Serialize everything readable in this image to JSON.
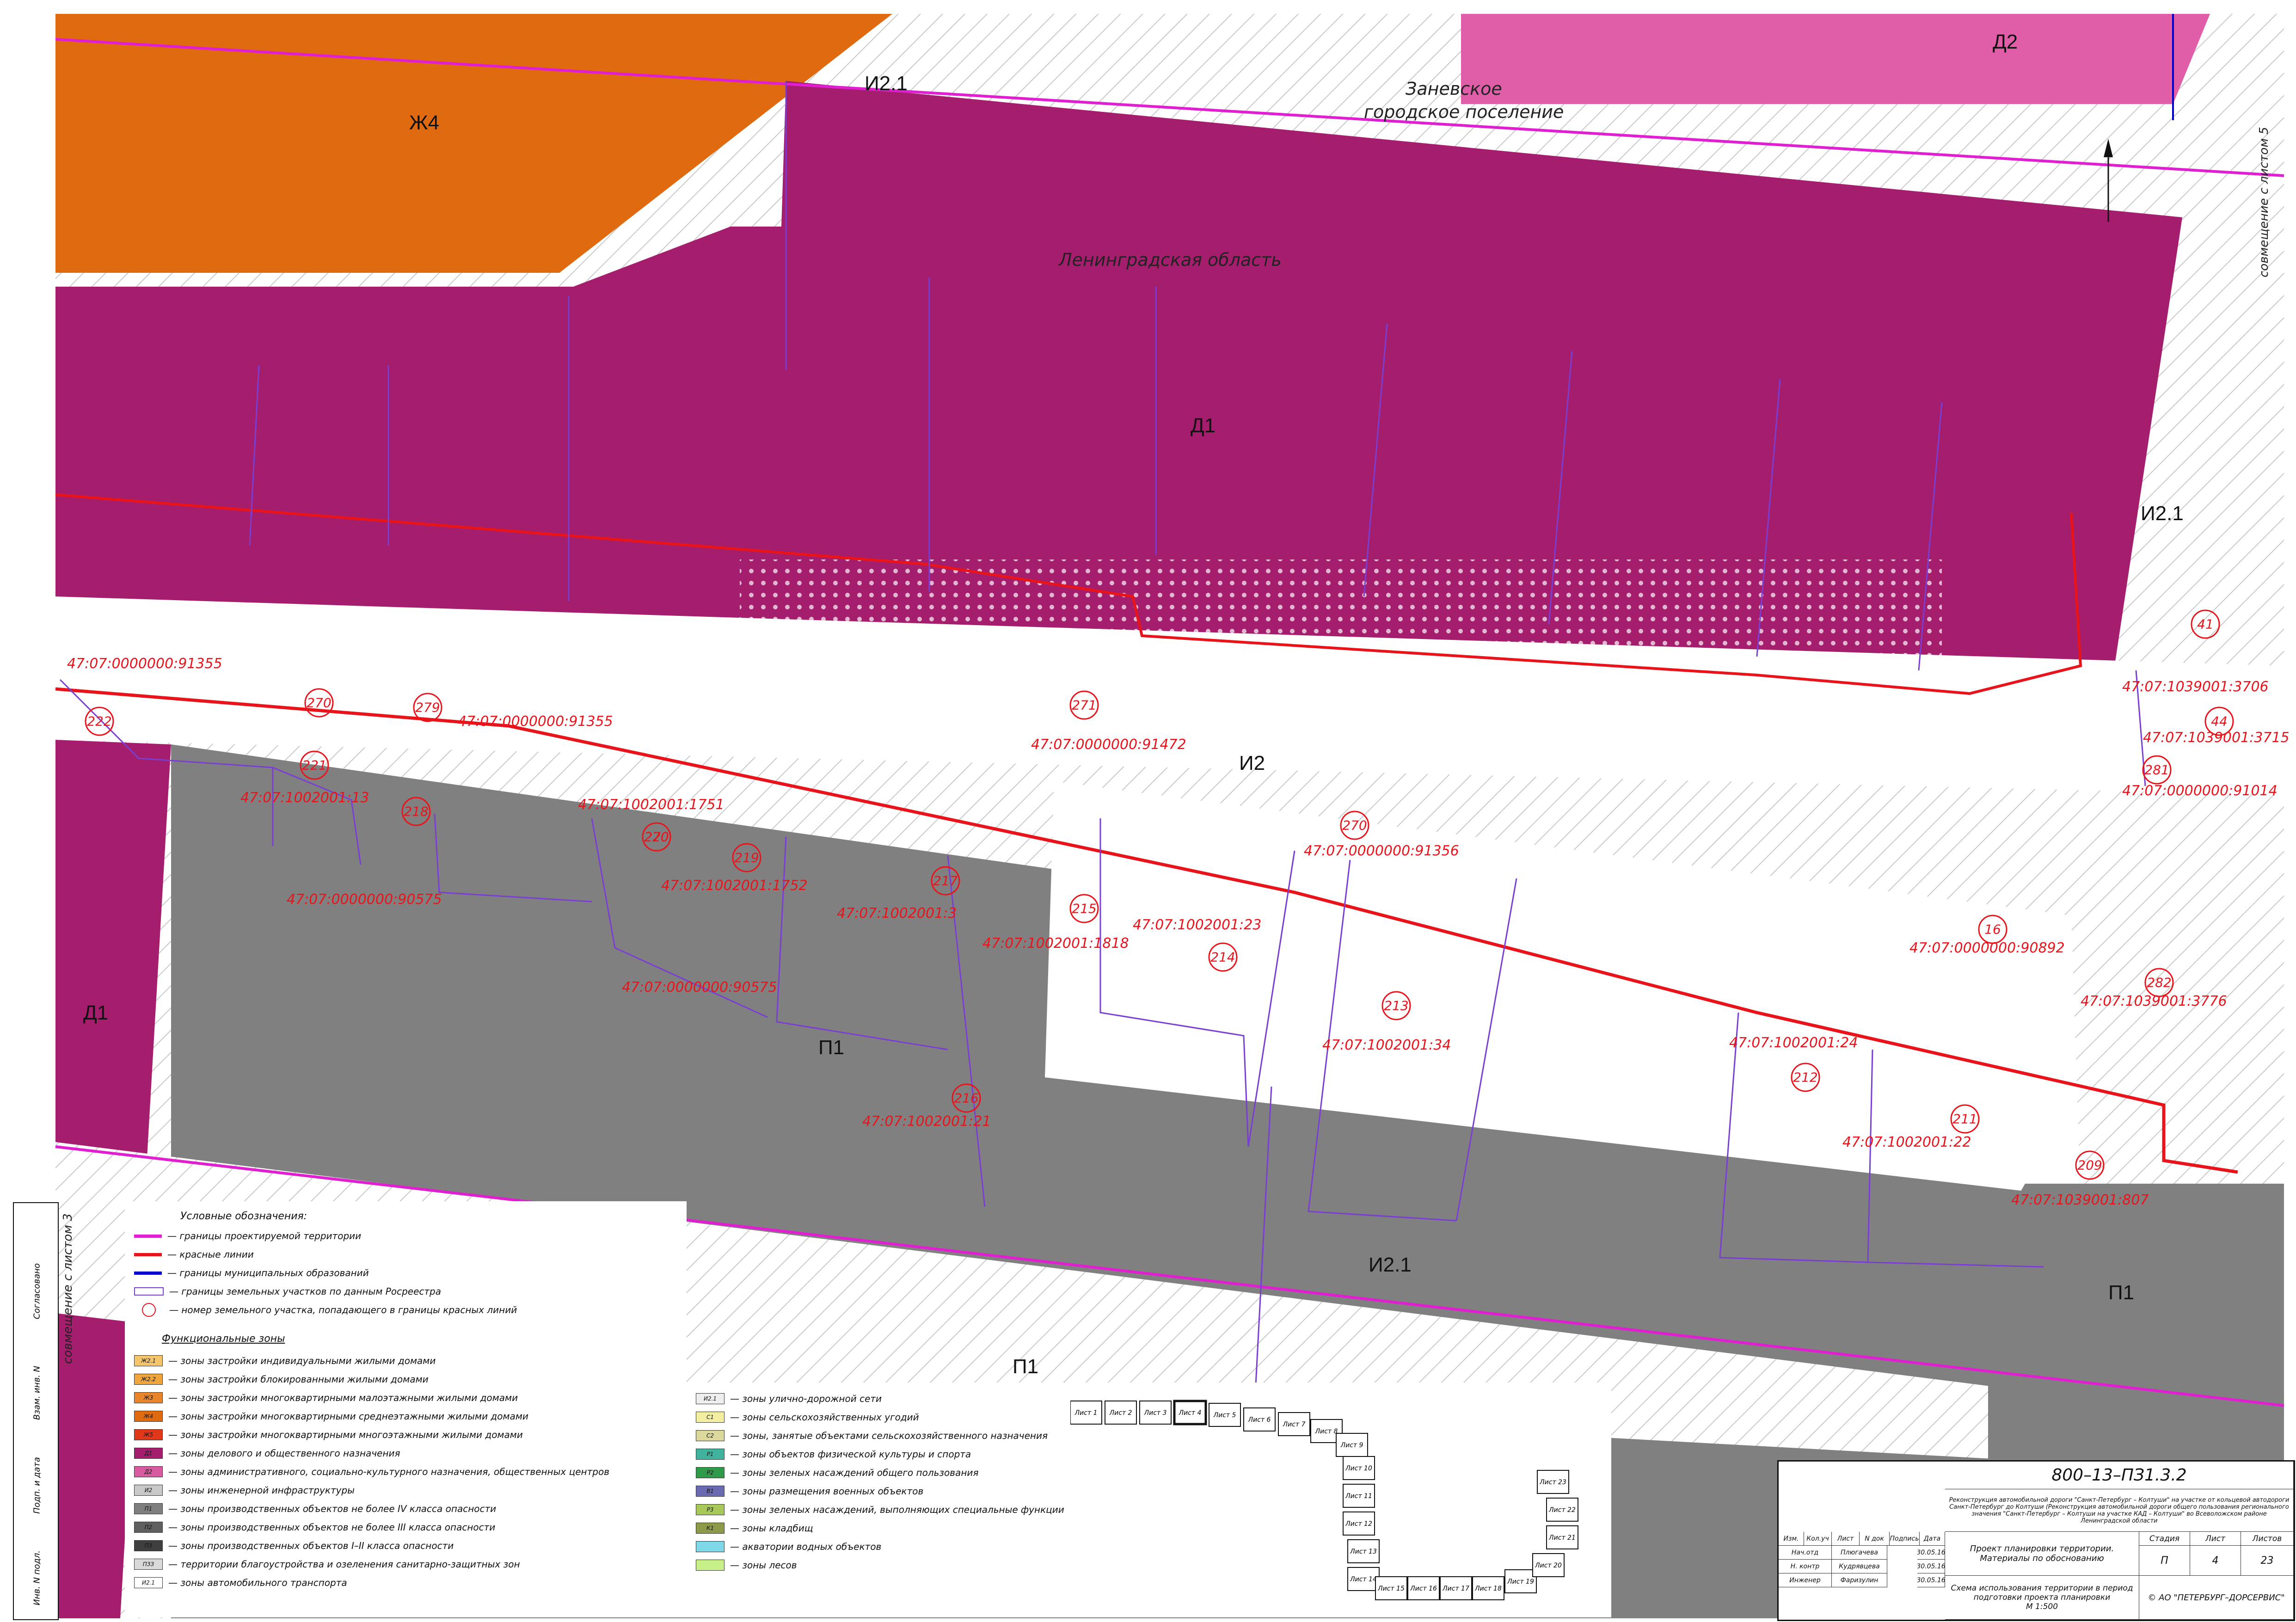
{
  "zones": {
    "zh4": "Ж4",
    "i21_top": "И2.1",
    "d2": "Д2",
    "d1_top": "Д1",
    "i21_right": "И2.1",
    "i2": "И2",
    "d1_left": "Д1",
    "p1_center": "П1",
    "i21_bottom": "И2.1",
    "p1_right": "П1",
    "p1_bottom": "П1"
  },
  "places": {
    "zanevskoe_1": "Заневское",
    "zanevskoe_2": "городское поселение",
    "leningrad": "Ленинградская область"
  },
  "side_notes": {
    "right": "совмещение с листом 5",
    "left": "совмещение с листом 3"
  },
  "parcels": [
    {
      "label": "47:07:0000000:91355"
    },
    {
      "label": "47:07:0000000:91355"
    },
    {
      "label": "47:07:0000000:91472"
    },
    {
      "label": "47:07:1002001:13"
    },
    {
      "label": "47:07:1002001:1751"
    },
    {
      "label": "47:07:1002001:1752"
    },
    {
      "label": "47:07:0000000:90575"
    },
    {
      "label": "47:07:1002001:3"
    },
    {
      "label": "47:07:1002001:1818"
    },
    {
      "label": "47:07:1002001:23"
    },
    {
      "label": "47:07:0000000:91356"
    },
    {
      "label": "47:07:0000000:90575"
    },
    {
      "label": "47:07:1002001:34"
    },
    {
      "label": "47:07:1002001:21"
    },
    {
      "label": "47:07:1002001:24"
    },
    {
      "label": "47:07:1002001:22"
    },
    {
      "label": "47:07:1039001:807"
    },
    {
      "label": "47:07:1039001:3706"
    },
    {
      "label": "47:07:1039001:3715"
    },
    {
      "label": "47:07:0000000:91014"
    },
    {
      "label": "47:07:0000000:90892"
    },
    {
      "label": "47:07:1039001:3776"
    }
  ],
  "plot_numbers": [
    "222",
    "270",
    "279",
    "221",
    "218",
    "270",
    "219",
    "217",
    "215",
    "214",
    "270",
    "213",
    "216",
    "212",
    "211",
    "209",
    "282",
    "16",
    "281",
    "44",
    "41",
    "271",
    "220"
  ],
  "legend": {
    "title": "Условные обозначения:",
    "lines": [
      {
        "label": "— границы проектируемой территории",
        "color": "#e020d0"
      },
      {
        "label": "— красные линии",
        "color": "#e8141b"
      },
      {
        "label": "— границы муниципальных образований",
        "color": "#0000cc"
      },
      {
        "label": "— границы земельных участков по данным Росреестра",
        "color": "#7a3fd0"
      },
      {
        "label": "— номер земельного участка, попадающего в границы красных линий",
        "color": "#e8141b"
      }
    ],
    "func_title": "Функциональные зоны",
    "zones_left": [
      {
        "code": "Ж2.1",
        "label": "— зоны застройки индивидуальными жилыми домами",
        "color": "#f5c56b"
      },
      {
        "code": "Ж2.2",
        "label": "— зоны застройки блокированными жилыми домами",
        "color": "#f0a43c"
      },
      {
        "code": "Ж3",
        "label": "— зоны застройки многоквартирными малоэтажными жилыми домами",
        "color": "#e8842a"
      },
      {
        "code": "Ж4",
        "label": "— зоны застройки многоквартирными среднеэтажными жилыми домами",
        "color": "#e06a10"
      },
      {
        "code": "Ж5",
        "label": "— зоны застройки многоквартирными многоэтажными жилыми домами",
        "color": "#e2381a"
      },
      {
        "code": "Д1",
        "label": "— зоны делового и общественного назначения",
        "color": "#a51e6e"
      },
      {
        "code": "Д2",
        "label": "— зоны административного, социально-культурного назначения, общественных центров",
        "color": "#d85aa0"
      },
      {
        "code": "И2",
        "label": "— зоны инженерной инфраструктуры",
        "color": "#c8c8c8"
      },
      {
        "code": "П1",
        "label": "— зоны производственных объектов не более IV класса опасности",
        "color": "#7f7f7f"
      },
      {
        "code": "П2",
        "label": "— зоны производственных объектов не более III класса опасности",
        "color": "#5f5f5f"
      },
      {
        "code": "П3",
        "label": "— зоны производственных объектов I–II класса опасности",
        "color": "#3f3f3f"
      },
      {
        "code": "ПЗЗ",
        "label": "— территории благоустройства и озеленения санитарно-защитных зон",
        "color": "#d9d9d9"
      },
      {
        "code": "И2.1",
        "label": "— зоны автомобильного транспорта",
        "color": "#ffffff"
      }
    ],
    "zones_right": [
      {
        "code": "И2.1",
        "label": "— зоны улично-дорожной сети",
        "color": "#eeeeee"
      },
      {
        "code": "С1",
        "label": "— зоны сельскохозяйственных угодий",
        "color": "#f2f0a0"
      },
      {
        "code": "С2",
        "label": "— зоны, занятые объектами сельскохозяйственного назначения",
        "color": "#dcd79a"
      },
      {
        "code": "Р1",
        "label": "— зоны объектов физической культуры и спорта",
        "color": "#3fb39e"
      },
      {
        "code": "Р2",
        "label": "— зоны зеленых насаждений общего пользования",
        "color": "#2e9a4a"
      },
      {
        "code": "В1",
        "label": "— зоны размещения военных объектов",
        "color": "#6a6ab0"
      },
      {
        "code": "Р3",
        "label": "— зоны зеленых насаждений, выполняющих специальные функции",
        "color": "#a8c85a"
      },
      {
        "code": "К1",
        "label": "— зоны кладбищ",
        "color": "#8d9a4a"
      },
      {
        "code": "",
        "label": "— акватории водных объектов",
        "color": "#7fd8e8"
      },
      {
        "code": "",
        "label": "— зоны лесов",
        "color": "#c8f08a"
      }
    ]
  },
  "sheets": [
    "Лист 1",
    "Лист 2",
    "Лист 3",
    "Лист 4",
    "Лист 5",
    "Лист 6",
    "Лист 7",
    "Лист 8",
    "Лист 9",
    "Лист 10",
    "Лист 11",
    "Лист 12",
    "Лист 13",
    "Лист 14",
    "Лист 15",
    "Лист 16",
    "Лист 17",
    "Лист 18",
    "Лист 19",
    "Лист 20",
    "Лист 21",
    "Лист 22",
    "Лист 23"
  ],
  "stamp": {
    "code": "800–13–ПЗ1.3.2",
    "project": "Реконструкция автомобильной дороги \"Санкт-Петербург – Колтуши\" на участке от кольцевой автодороги Санкт-Петербург до Колтуши (Реконструкция автомобильной дороги общего пользования регионального значения \"Санкт-Петербург – Колтуши на участке КАД – Колтуши\" во Всеволожском районе Ленинградской области",
    "headers": [
      "Изм.",
      "Кол.уч",
      "Лист",
      "N док",
      "Подпись",
      "Дата"
    ],
    "rows": [
      {
        "role": "Нач.отд",
        "name": "Плюгачева",
        "date": "30.05.16"
      },
      {
        "role": "Н. контр",
        "name": "Кудрявцева",
        "date": "30.05.16"
      },
      {
        "role": "Инженер",
        "name": "Фаризулин",
        "date": "30.05.16"
      }
    ],
    "doc1": "Проект планировки территории.",
    "doc2": "Материалы по обоснованию",
    "stage_h": "Стадия",
    "sheet_h": "Лист",
    "sheets_h": "Листов",
    "stage": "П",
    "sheet": "4",
    "sheets_total": "23",
    "drawing1": "Схема использования территории в период",
    "drawing2": "подготовки проекта планировки",
    "scale": "М 1:500",
    "company": "© АО \"ПЕТЕРБУРГ–ДОРСЕРВИС\""
  },
  "frame_left": {
    "agreed": "Согласовано",
    "inv1": "Взам. инв. N",
    "sign": "Подп. и дата",
    "inv2": "Инв. N подл."
  },
  "colors": {
    "d1": "#a51e6e",
    "d2": "#e05ea8",
    "zh4": "#e06a10",
    "p1": "#808080",
    "red_line": "#e8141b",
    "boundary": "#e020d0",
    "parcel": "#7a3fd0"
  }
}
